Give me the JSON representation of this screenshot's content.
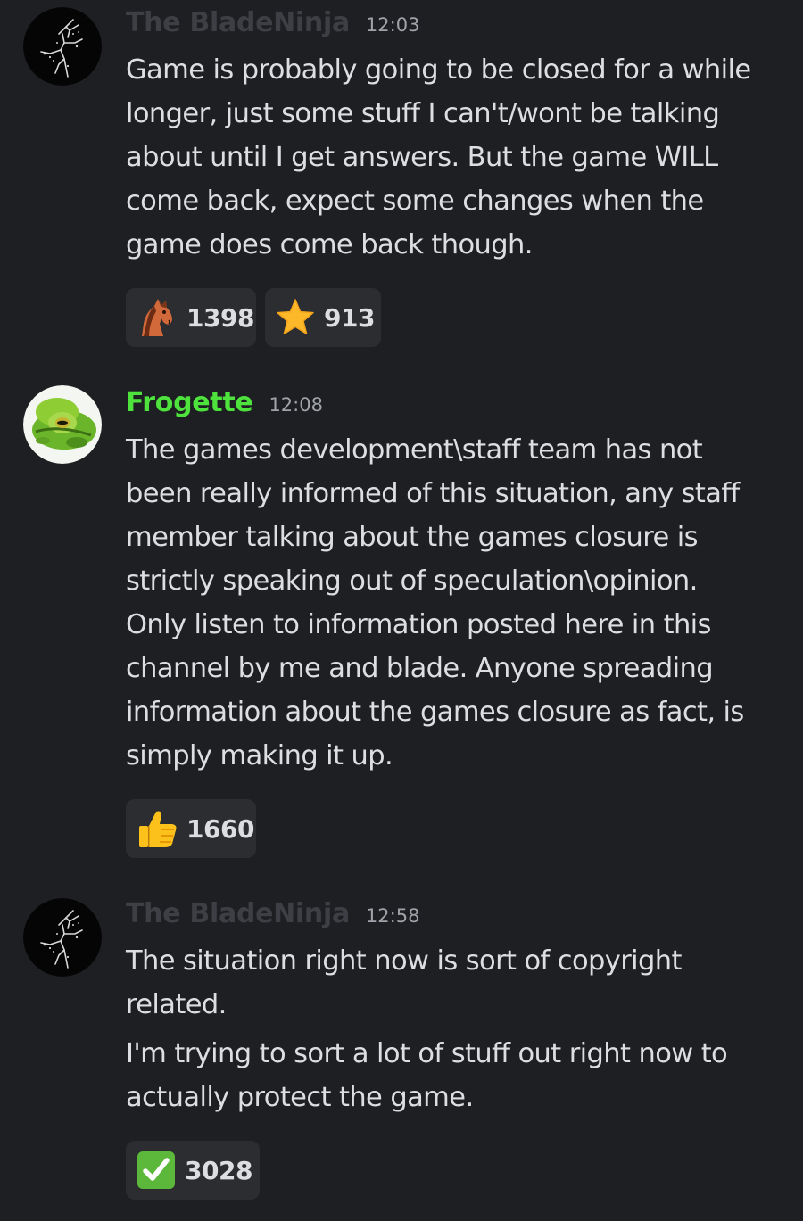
{
  "messages": [
    {
      "author": "The BladeNinja",
      "time": "12:03",
      "avatar_icon": "ninja-avatar-icon",
      "author_color": "#3d3f45",
      "paragraphs": [
        {
          "lines": [
            "Game is probably going to be closed for a while",
            "longer, just some stuff I can't/wont be talking",
            "about until I get answers. But the game WILL",
            "come back, expect some changes when the",
            "game does come back though."
          ]
        }
      ],
      "reactions": [
        {
          "emoji": "horse-icon",
          "count": "1398"
        },
        {
          "emoji": "star-icon",
          "count": "913"
        }
      ]
    },
    {
      "author": "Frogette",
      "time": "12:08",
      "avatar_icon": "frog-avatar-icon",
      "author_color": "#4ee23d",
      "paragraphs": [
        {
          "lines": [
            "The games development\\staff team has not",
            "been really informed of this situation, any staff",
            "member talking about the games closure is",
            "strictly speaking out of speculation\\opinion.",
            "Only listen to information posted here in this",
            "channel by me and blade. Anyone spreading",
            "information about the games closure as fact, is",
            "simply making it up."
          ]
        }
      ],
      "reactions": [
        {
          "emoji": "thumbs-up-icon",
          "count": "1660"
        }
      ]
    },
    {
      "author": "The BladeNinja",
      "time": "12:58",
      "avatar_icon": "ninja-avatar-icon",
      "author_color": "#3d3f45",
      "paragraphs": [
        {
          "lines": [
            "The situation right now is sort of copyright",
            "related."
          ]
        },
        {
          "lines": [
            "I'm trying to sort a lot of stuff out right now to",
            "actually protect the game."
          ]
        }
      ],
      "reactions": [
        {
          "emoji": "check-mark-icon",
          "count": "3028"
        }
      ]
    }
  ]
}
